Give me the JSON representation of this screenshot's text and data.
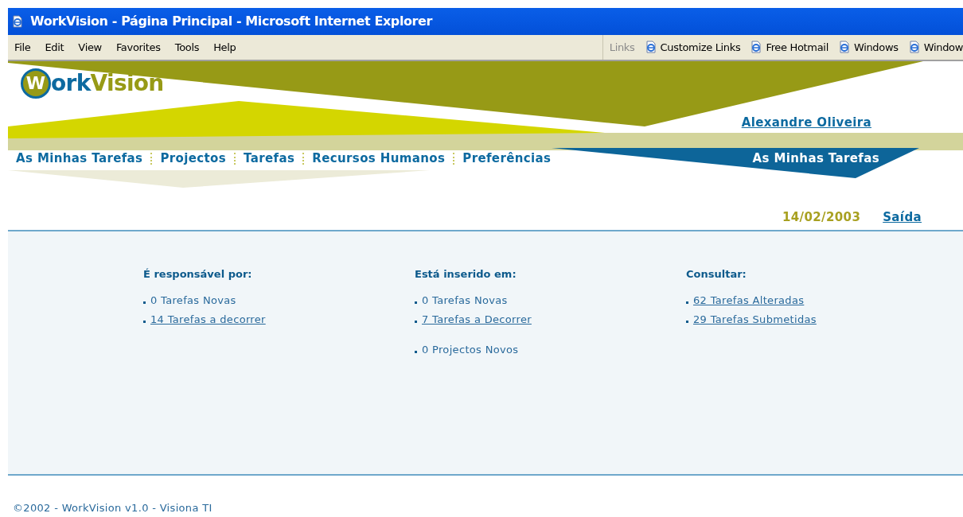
{
  "window": {
    "title": "WorkVision - Página Principal - Microsoft Internet Explorer"
  },
  "menu": [
    "File",
    "Edit",
    "View",
    "Favorites",
    "Tools",
    "Help"
  ],
  "links_bar": {
    "label": "Links",
    "items": [
      "Customize Links",
      "Free Hotmail",
      "Windows",
      "Window"
    ]
  },
  "logo": {
    "initial": "W",
    "part_1": "ork",
    "part_2": "Vision"
  },
  "user": "Alexandre Oliveira",
  "nav": [
    "As Minhas Tarefas",
    "Projectos",
    "Tarefas",
    "Recursos Humanos",
    "Preferências"
  ],
  "section_title": "As Minhas Tarefas",
  "date": "14/02/2003",
  "logout": "Saída",
  "columns": [
    {
      "title": "É responsável por:",
      "groups": [
        [
          {
            "text": "0 Tarefas Novas",
            "link": false
          },
          {
            "text": "14 Tarefas a decorrer",
            "link": true
          }
        ]
      ]
    },
    {
      "title": "Está inserido em:",
      "groups": [
        [
          {
            "text": "0 Tarefas Novas",
            "link": false
          },
          {
            "text": "7 Tarefas a Decorrer",
            "link": true
          }
        ],
        [
          {
            "text": "0 Projectos Novos",
            "link": false
          }
        ]
      ]
    },
    {
      "title": "Consultar:",
      "groups": [
        [
          {
            "text": "62 Tarefas Alteradas",
            "link": true
          },
          {
            "text": "29 Tarefas Submetidas",
            "link": true
          }
        ]
      ]
    }
  ],
  "footer": "©2002 - WorkVision v1.0 - Visiona TI"
}
